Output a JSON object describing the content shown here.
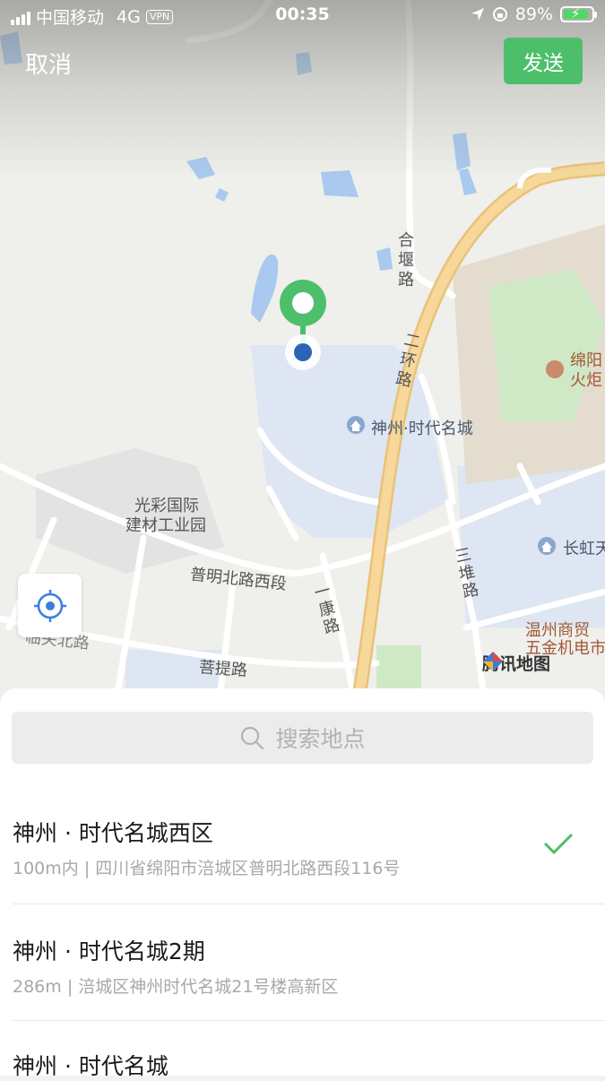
{
  "status_bar": {
    "carrier": "中国移动",
    "network": "4G",
    "vpn": "VPN",
    "time": "00:35",
    "battery": "89%"
  },
  "header": {
    "cancel_label": "取消",
    "send_label": "发送"
  },
  "map": {
    "labels": {
      "road_hexy": "合堰路",
      "road_ring2": "二环路",
      "poi_shenzhou": "神州·时代名城",
      "poi_guangcai": "光彩国际建材工业园",
      "poi_guangcai_1": "光彩国际",
      "poi_guangcai_2": "建材工业园",
      "road_puming": "普明北路西段",
      "road_yikang": "一康路",
      "road_sandui": "三堆路",
      "road_puti": "菩提路",
      "road_left": "临关北路",
      "poi_changhong": "长虹天",
      "poi_mianyang": "绵阳火炬",
      "poi_mianyang_1": "绵阳",
      "poi_mianyang_2": "火炬",
      "poi_wenzhou": "温州商贸五金机电市场",
      "poi_wenzhou_1": "温州商贸",
      "poi_wenzhou_2": "五金机电市"
    },
    "provider": "腾讯地图",
    "colors": {
      "pin": "#4dbf6b",
      "location_dot": "#2b63b6",
      "road_major": "#f5c86a",
      "water": "#a9c9ee",
      "park": "#cfe8c6"
    }
  },
  "search": {
    "placeholder": "搜索地点"
  },
  "results": [
    {
      "name": "神州 · 时代名城西区",
      "address": "100m内 | 四川省绵阳市涪城区普明北路西段116号",
      "selected": true
    },
    {
      "name": "神州 · 时代名城2期",
      "address": "286m | 涪城区神州时代名城21号楼高新区",
      "selected": false
    },
    {
      "name": "神州 · 时代名城",
      "address": "",
      "selected": false
    }
  ]
}
